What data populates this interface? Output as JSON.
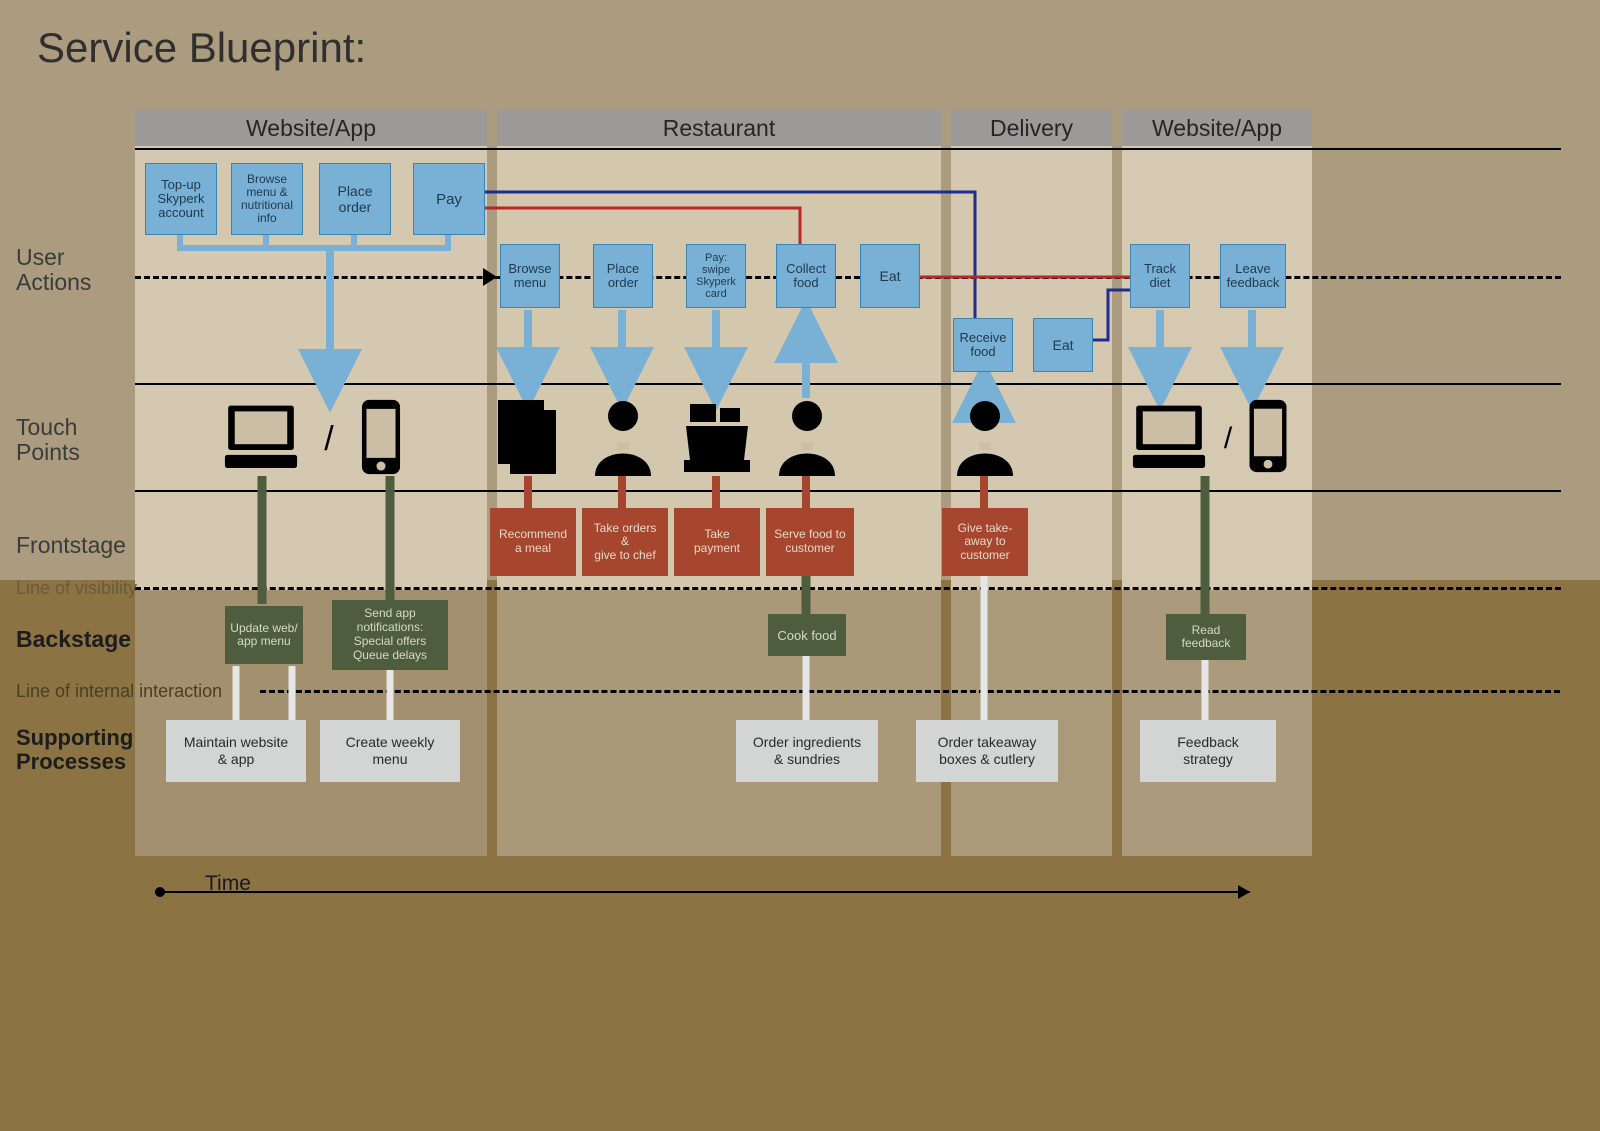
{
  "title": "Service Blueprint:",
  "section_headers": {
    "website_app1": "Website/App",
    "restaurant": "Restaurant",
    "delivery": "Delivery",
    "website_app2": "Website/App"
  },
  "swimlanes": {
    "user_actions": "User\nActions",
    "touch_points": "Touch\nPoints",
    "frontstage": "Frontstage",
    "backstage": "Backstage",
    "supporting": "Supporting\nProcesses",
    "line_visibility": "Line of visibility",
    "line_internal": "Line of internal interaction"
  },
  "timeline_label": "Time",
  "user_actions_top": {
    "topup": "Top-up\nSkyperk\naccount",
    "browse_menu_info": "Browse\nmenu &\nnutritional\ninfo",
    "place_order": "Place\norder",
    "pay": "Pay"
  },
  "user_actions_mid": {
    "browse_menu": "Browse\nmenu",
    "place_order": "Place\norder",
    "pay_swipe": "Pay:\nswipe\nSkyperk\ncard",
    "collect_food": "Collect\nfood",
    "eat1": "Eat",
    "receive_food": "Receive\nfood",
    "eat2": "Eat",
    "track_diet": "Track\ndiet",
    "leave_feedback": "Leave\nfeedback"
  },
  "frontstage_boxes": {
    "recommend": "Recommend\na meal",
    "take_orders": "Take orders\n&\ngive to chef",
    "take_payment": "Take\npayment",
    "serve_food": "Serve food to\ncustomer",
    "give_takeaway": "Give take-\naway to\ncustomer"
  },
  "backstage_boxes": {
    "update_menu": "Update web/\napp menu",
    "send_notif": "Send app\nnotifications:\nSpecial offers\nQueue delays",
    "cook_food": "Cook food",
    "read_feedback": "Read\nfeedback"
  },
  "supporting_boxes": {
    "maintain": "Maintain website\n& app",
    "create_menu": "Create weekly\nmenu",
    "order_ingredients": "Order ingredients\n& sundries",
    "order_takeaway": "Order takeaway\nboxes & cutlery",
    "feedback_strategy": "Feedback\nstrategy"
  },
  "touch_point_slash": "/",
  "colors": {
    "bg_top": "#ac9c7f",
    "bg_bottom": "#89703f",
    "band_light": "#cbbea5",
    "section_header_bg": "#9b9a99",
    "blue_box": "#79b0d6",
    "blue_box_border": "#3886b5",
    "red_box": "#a6462e",
    "green_box": "#4d5d3e",
    "grey_box": "#d3d5d4",
    "text_dark": "#3b3b3b",
    "line_red": "#b02a2a",
    "line_blue": "#1e2d8f"
  }
}
